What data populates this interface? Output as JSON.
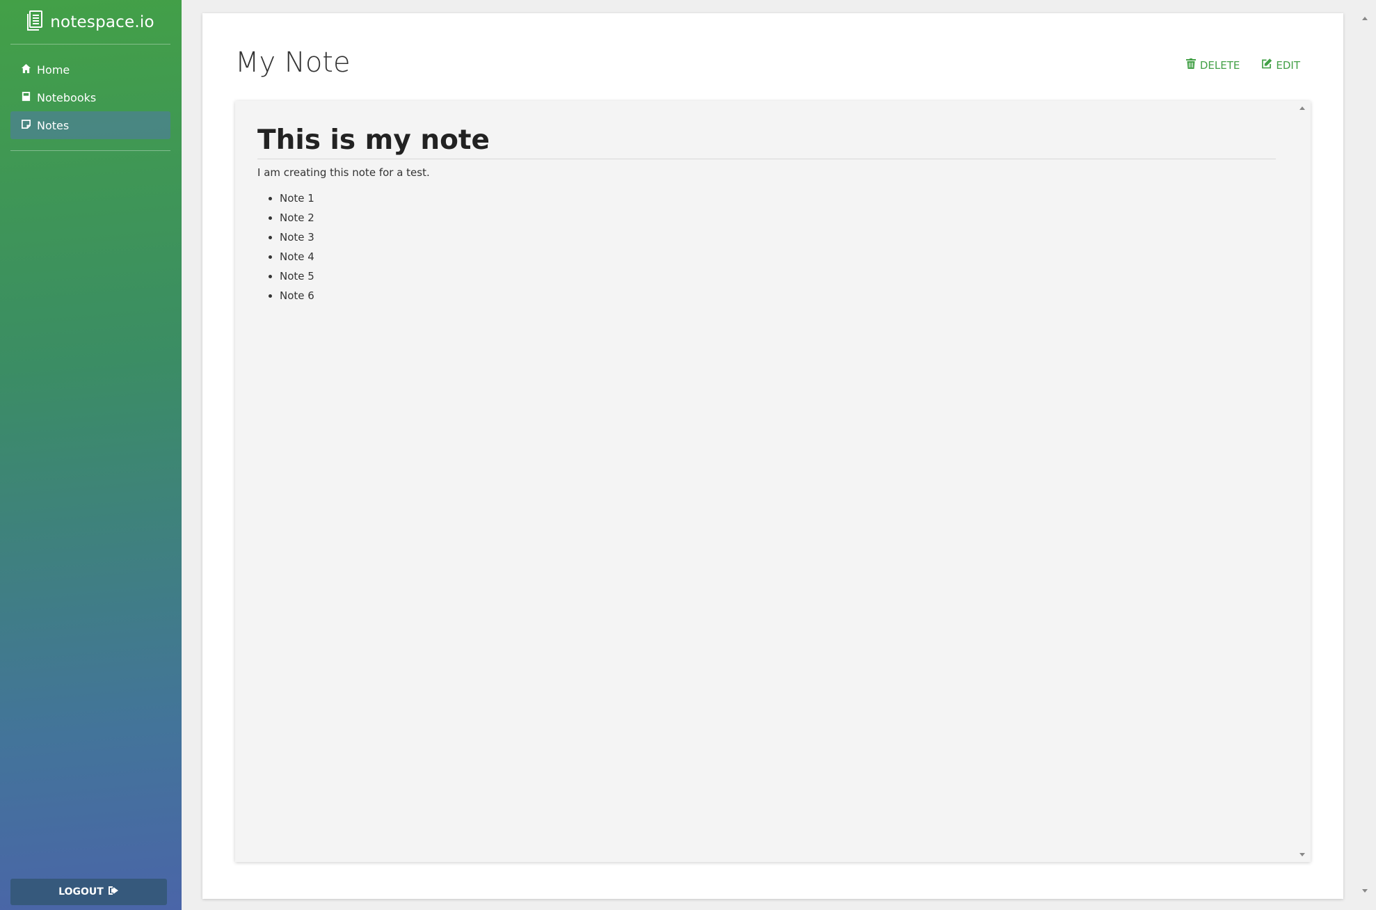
{
  "sidebar": {
    "brand": {
      "name": "notespace.io",
      "icon": "document-icon"
    },
    "nav": [
      {
        "label": "Home",
        "icon": "home-icon",
        "active": false
      },
      {
        "label": "Notebooks",
        "icon": "book-icon",
        "active": false
      },
      {
        "label": "Notes",
        "icon": "note-icon",
        "active": true
      }
    ],
    "logout_label": "LOGOUT",
    "logout_icon": "sign-out-icon"
  },
  "main": {
    "title": "My Note",
    "actions": {
      "delete_label": "DELETE",
      "edit_label": "EDIT"
    },
    "note": {
      "heading": "This is my note",
      "paragraph": "I am creating this note for a test.",
      "items": [
        "Note 1",
        "Note 2",
        "Note 3",
        "Note 4",
        "Note 5",
        "Note 6"
      ]
    }
  },
  "colors": {
    "accent": "#43a047",
    "sidebar_gradient_top": "#43a047",
    "sidebar_gradient_bottom": "#4a65a8",
    "logout_bg": "#36597c",
    "active_nav_bg": "#4f78aa"
  }
}
